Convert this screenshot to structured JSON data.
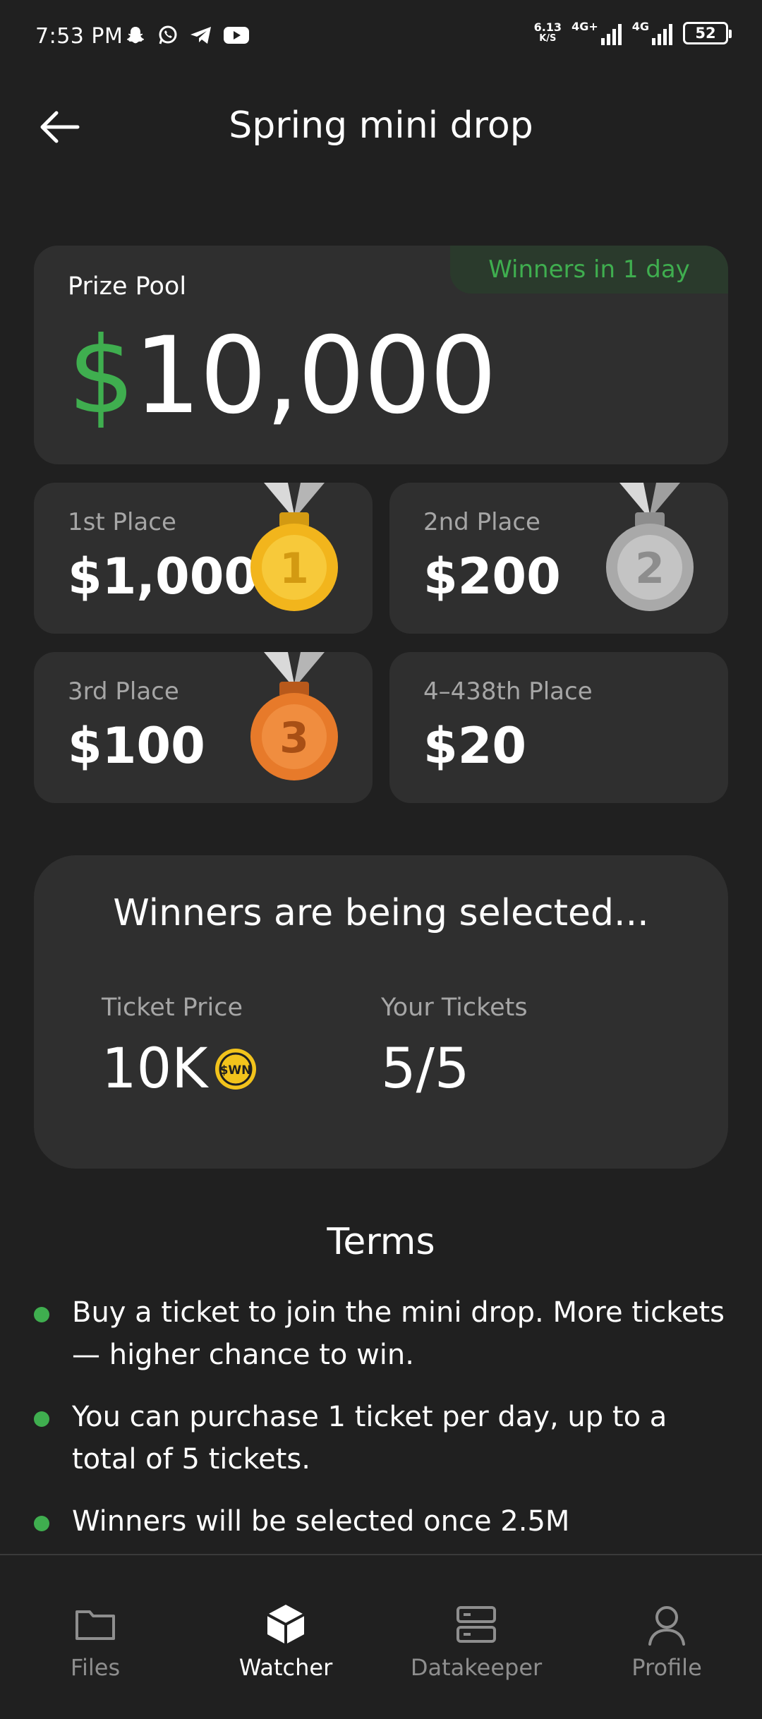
{
  "status_bar": {
    "time": "7:53 PM",
    "speed_value": "6.13",
    "speed_unit": "K/S",
    "net1_label": "4G+",
    "net2_label": "4G",
    "battery": "52",
    "icons": [
      "snapchat-icon",
      "whatsapp-icon",
      "telegram-icon",
      "youtube-icon"
    ]
  },
  "header": {
    "title": "Spring mini drop",
    "back_icon": "arrow-left-icon"
  },
  "prize_pool": {
    "label": "Prize Pool",
    "currency": "$",
    "amount": "10,000",
    "badge": "Winners in 1 day"
  },
  "places": [
    {
      "label": "1st Place",
      "amount": "$1,000",
      "medal": "1",
      "medal_color": "#f2b51c"
    },
    {
      "label": "2nd Place",
      "amount": "$200",
      "medal": "2",
      "medal_color": "#b8b8b8"
    },
    {
      "label": "3rd Place",
      "amount": "$100",
      "medal": "3",
      "medal_color": "#e77a2a"
    },
    {
      "label": "4–438th Place",
      "amount": "$20"
    }
  ],
  "selection": {
    "title": "Winners are being selected...",
    "ticket_price_label": "Ticket Price",
    "ticket_price_value": "10K",
    "coin_label": "$WN",
    "your_tickets_label": "Your Tickets",
    "your_tickets_value": "5/5"
  },
  "terms": {
    "title": "Terms",
    "items": [
      "Buy a ticket to join the mini drop. More tickets — higher chance to win.",
      "You can purchase 1 ticket per day, up to a total of 5 tickets.",
      "Winners will be selected once 2.5M"
    ]
  },
  "nav": {
    "items": [
      {
        "label": "Files",
        "icon": "folder-icon"
      },
      {
        "label": "Watcher",
        "icon": "cube-icon"
      },
      {
        "label": "Datakeeper",
        "icon": "server-icon"
      },
      {
        "label": "Profile",
        "icon": "user-icon"
      }
    ],
    "active": "Watcher"
  },
  "colors": {
    "background": "#202020",
    "card": "#2f2f2f",
    "accent_green": "#3fae4f",
    "muted_text": "#a6a6a6"
  }
}
